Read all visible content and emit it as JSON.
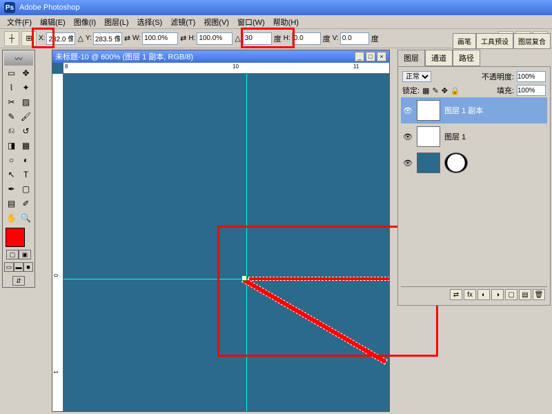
{
  "app": {
    "title": "Adobe Photoshop"
  },
  "menu": {
    "file": "文件(F)",
    "edit": "编辑(E)",
    "image": "图像(I)",
    "layer": "图层(L)",
    "select": "选择(S)",
    "filter": "滤镜(T)",
    "view": "视图(V)",
    "window": "窗口(W)",
    "help": "帮助(H)"
  },
  "opt": {
    "x_label": "X:",
    "x": "282.0 像",
    "y_label": "Y:",
    "y": "283.5 像",
    "w_label": "W:",
    "w": "100.0%",
    "h_label": "H:",
    "h": "100.0%",
    "angle": "30",
    "angle_unit": "度",
    "h2_label": "H:",
    "h2": "0.0",
    "h2_unit": "度",
    "v_label": "V:",
    "v": "0.0",
    "v_unit": "度"
  },
  "topPresets": {
    "brush": "画笔",
    "tool": "工具预设",
    "comp": "图层复合"
  },
  "doc": {
    "title": "未标题-10 @ 600% (图层 1 副本, RGB/8)",
    "ruler10": "10",
    "ruler11": "11",
    "ruler8": "8",
    "rv0": "0",
    "rv1": "1"
  },
  "panel": {
    "tabs": {
      "layers": "图层",
      "channels": "通道",
      "paths": "路径"
    },
    "mode": "正常",
    "opacity_label": "不透明度:",
    "opacity": "100%",
    "lock_label": "锁定:",
    "fill_label": "填充:",
    "fill": "100%",
    "layers_list": [
      {
        "name": "图层 1 副本"
      },
      {
        "name": "图层 1"
      },
      {
        "name": ""
      }
    ]
  },
  "icons": {
    "ref": "⊞",
    "triangle": "△",
    "link": "⇄",
    "check": "✓",
    "cancel": "⊘",
    "eye": "👁"
  }
}
